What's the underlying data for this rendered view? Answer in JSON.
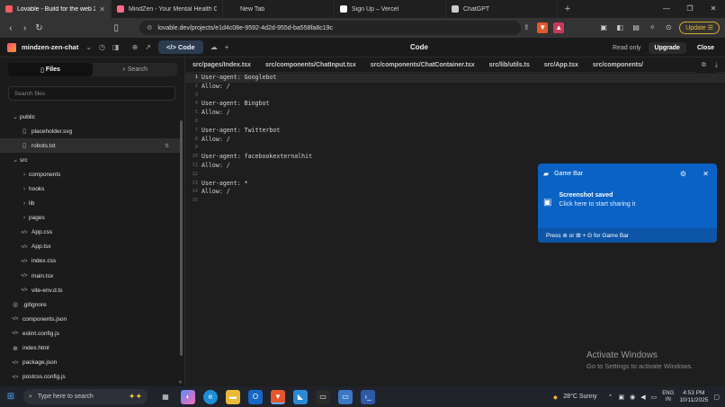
{
  "browser": {
    "tabs": [
      {
        "label": "Lovable - Build for the web 20x",
        "fav_color": "#ff5a5f",
        "active": true
      },
      {
        "label": "MindZen - Your Mental Health Comp",
        "fav_color": "#ff6a8c",
        "active": false
      },
      {
        "label": "New Tab",
        "fav_color": "",
        "active": false
      },
      {
        "label": "Sign Up – Vercel",
        "fav_color": "#ffffff",
        "active": false
      },
      {
        "label": "ChatGPT",
        "fav_color": "#cccccc",
        "active": false
      }
    ],
    "url": "lovable.dev/projects/e1d4c08e-9592-4d2d-955d-ba558fa8c19c",
    "update_label": "Update"
  },
  "app": {
    "project_name": "mindzen-zen-chat",
    "code_button": "Code",
    "center_title": "Code",
    "readonly_label": "Read only",
    "upgrade_label": "Upgrade",
    "close_label": "Close"
  },
  "sidebar": {
    "files_tab": "Files",
    "search_tab": "Search",
    "search_placeholder": "Search files",
    "tree": [
      {
        "label": "public",
        "type": "folder-open",
        "indent": 0
      },
      {
        "label": "placeholder.svg",
        "type": "file",
        "indent": 1
      },
      {
        "label": "robots.txt",
        "type": "file",
        "indent": 1,
        "selected": true
      },
      {
        "label": "src",
        "type": "folder-open",
        "indent": 0
      },
      {
        "label": "components",
        "type": "folder",
        "indent": 1
      },
      {
        "label": "hooks",
        "type": "folder",
        "indent": 1
      },
      {
        "label": "lib",
        "type": "folder",
        "indent": 1
      },
      {
        "label": "pages",
        "type": "folder",
        "indent": 1
      },
      {
        "label": "App.css",
        "type": "code",
        "indent": 1
      },
      {
        "label": "App.tsx",
        "type": "code",
        "indent": 1
      },
      {
        "label": "index.css",
        "type": "code",
        "indent": 1
      },
      {
        "label": "main.tsx",
        "type": "code",
        "indent": 1
      },
      {
        "label": "vite-env.d.ts",
        "type": "code",
        "indent": 1
      },
      {
        "label": ".gitignore",
        "type": "git",
        "indent": 0
      },
      {
        "label": "components.json",
        "type": "code",
        "indent": 0
      },
      {
        "label": "eslint.config.js",
        "type": "code",
        "indent": 0
      },
      {
        "label": "index.html",
        "type": "web",
        "indent": 0
      },
      {
        "label": "package.json",
        "type": "code",
        "indent": 0
      },
      {
        "label": "postcss.config.js",
        "type": "code",
        "indent": 0
      }
    ]
  },
  "editor": {
    "file_tabs": [
      "src/pages/Index.tsx",
      "src/components/ChatInput.tsx",
      "src/components/ChatContainer.tsx",
      "src/lib/utils.ts",
      "src/App.tsx",
      "src/components/"
    ],
    "lines": [
      "User-agent: Googlebot",
      "Allow: /",
      "",
      "User-agent: Bingbot",
      "Allow: /",
      "",
      "User-agent: Twitterbot",
      "Allow: /",
      "",
      "User-agent: facebookexternalhit",
      "Allow: /",
      "",
      "User-agent: *",
      "Allow: /",
      ""
    ]
  },
  "toast": {
    "app_name": "Game Bar",
    "title": "Screenshot saved",
    "subtitle": "Click here to start sharing it",
    "footer": "Press ⊛ or ⊞ + G for Game Bar"
  },
  "watermark": {
    "title": "Activate Windows",
    "subtitle": "Go to Settings to activate Windows."
  },
  "taskbar": {
    "search_placeholder": "Type here to search",
    "weather": "28°C  Sunny",
    "lang_top": "ENG",
    "lang_bottom": "IN",
    "time": "4:53 PM",
    "date": "10/11/2025"
  }
}
